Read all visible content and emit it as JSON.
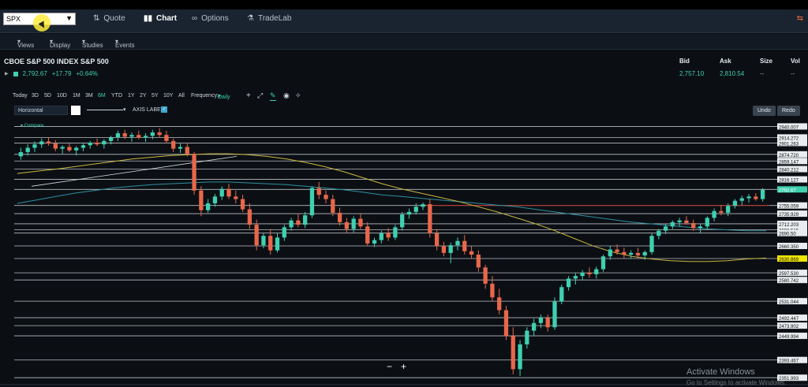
{
  "nav": {
    "symbol": "SPX",
    "tabs": [
      {
        "label": "Quote",
        "icon": "quote-icon"
      },
      {
        "label": "Chart",
        "icon": "chart-icon"
      },
      {
        "label": "Options",
        "icon": "options-icon"
      },
      {
        "label": "TradeLab",
        "icon": "tradelab-icon"
      }
    ]
  },
  "subnav": {
    "views": "Views",
    "display": "Display",
    "studies": "Studies",
    "events": "Events"
  },
  "instrument": {
    "title": "CBOE S&P 500 INDEX S&P 500",
    "last": "2,792.67",
    "change": "+17.79",
    "change_pct": "+0.64%"
  },
  "quote": {
    "bid_label": "Bid",
    "bid": "2,757.10",
    "ask_label": "Ask",
    "ask": "2,810.54",
    "size_label": "Size",
    "size": "--",
    "vol_label": "Vol",
    "vol": "--"
  },
  "toolbar": {
    "ranges": [
      "Today",
      "3D",
      "5D",
      "10D",
      "1M",
      "3M",
      "6M",
      "YTD",
      "1Y",
      "2Y",
      "5Y",
      "10Y",
      "All"
    ],
    "frequency_label": "Frequency:",
    "frequency": "Daily",
    "draw_tool": "Horizontal",
    "axis_label": "AXIS LABEL:",
    "undo": "Undo",
    "redo": "Redo"
  },
  "compare_label": "Compare...",
  "zoom": {
    "minus": "−",
    "plus": "+"
  },
  "watermark": {
    "title": "Activate Windows",
    "sub": "Go to Settings to activate Windows."
  },
  "colors": {
    "up": "#3fd0b0",
    "down": "#e8674a",
    "ma_short": "#c8b640",
    "ma_long": "#2f8fa0",
    "red_line": "#c0342f"
  },
  "chart_data": {
    "type": "candlestick",
    "y_axis_levels": [
      "2940.007",
      "2914.272",
      "2901.263",
      "2874.720",
      "2859.147",
      "2840.212",
      "2816.127",
      "2792.67",
      "2755.059",
      "2735.929",
      "2712.203",
      "2698.515",
      "2690.50",
      "2660.350",
      "2630.869",
      "2597.530",
      "2580.742",
      "2531.044",
      "2492.447",
      "2473.902",
      "2449.994",
      "2393.467",
      "2351.993"
    ],
    "y_axis_price_values": [
      2940.007,
      2914.272,
      2901.263,
      2874.72,
      2859.147,
      2840.212,
      2816.127,
      2792.67,
      2755.059,
      2735.929,
      2712.203,
      2698.515,
      2690.5,
      2660.35,
      2630.869,
      2597.53,
      2580.742,
      2531.044,
      2492.447,
      2473.902,
      2449.994,
      2393.467,
      2351.993
    ],
    "highlight_levels": {
      "last": "2792.67",
      "yellow": "2630.869"
    },
    "ylim": [
      2345,
      2950
    ],
    "candles": [
      [
        2870,
        2890,
        2862,
        2880
      ],
      [
        2880,
        2898,
        2872,
        2890
      ],
      [
        2890,
        2905,
        2880,
        2898
      ],
      [
        2898,
        2912,
        2890,
        2905
      ],
      [
        2905,
        2915,
        2895,
        2900
      ],
      [
        2900,
        2908,
        2882,
        2888
      ],
      [
        2888,
        2896,
        2876,
        2892
      ],
      [
        2892,
        2900,
        2880,
        2884
      ],
      [
        2884,
        2894,
        2872,
        2890
      ],
      [
        2890,
        2902,
        2882,
        2896
      ],
      [
        2896,
        2906,
        2888,
        2902
      ],
      [
        2902,
        2912,
        2894,
        2898
      ],
      [
        2898,
        2910,
        2888,
        2906
      ],
      [
        2906,
        2918,
        2898,
        2914
      ],
      [
        2914,
        2930,
        2906,
        2924
      ],
      [
        2924,
        2932,
        2910,
        2916
      ],
      [
        2916,
        2926,
        2904,
        2920
      ],
      [
        2920,
        2930,
        2910,
        2914
      ],
      [
        2914,
        2924,
        2904,
        2918
      ],
      [
        2918,
        2932,
        2910,
        2926
      ],
      [
        2926,
        2936,
        2914,
        2920
      ],
      [
        2920,
        2930,
        2900,
        2906
      ],
      [
        2906,
        2912,
        2880,
        2888
      ],
      [
        2888,
        2900,
        2878,
        2892
      ],
      [
        2892,
        2902,
        2870,
        2876
      ],
      [
        2876,
        2880,
        2780,
        2790
      ],
      [
        2790,
        2800,
        2730,
        2744
      ],
      [
        2744,
        2770,
        2738,
        2760
      ],
      [
        2760,
        2782,
        2752,
        2776
      ],
      [
        2776,
        2800,
        2768,
        2794
      ],
      [
        2794,
        2806,
        2770,
        2776
      ],
      [
        2776,
        2790,
        2760,
        2770
      ],
      [
        2770,
        2780,
        2740,
        2746
      ],
      [
        2746,
        2760,
        2700,
        2710
      ],
      [
        2710,
        2722,
        2650,
        2662
      ],
      [
        2662,
        2690,
        2655,
        2684
      ],
      [
        2684,
        2700,
        2640,
        2650
      ],
      [
        2650,
        2690,
        2645,
        2680
      ],
      [
        2680,
        2710,
        2672,
        2704
      ],
      [
        2704,
        2726,
        2696,
        2720
      ],
      [
        2720,
        2736,
        2704,
        2710
      ],
      [
        2710,
        2740,
        2702,
        2732
      ],
      [
        2732,
        2800,
        2726,
        2796
      ],
      [
        2796,
        2810,
        2770,
        2780
      ],
      [
        2780,
        2790,
        2760,
        2770
      ],
      [
        2770,
        2780,
        2730,
        2738
      ],
      [
        2738,
        2750,
        2708,
        2716
      ],
      [
        2716,
        2726,
        2690,
        2700
      ],
      [
        2700,
        2730,
        2692,
        2724
      ],
      [
        2724,
        2736,
        2700,
        2706
      ],
      [
        2706,
        2716,
        2660,
        2666
      ],
      [
        2666,
        2680,
        2658,
        2674
      ],
      [
        2674,
        2696,
        2666,
        2690
      ],
      [
        2690,
        2702,
        2672,
        2680
      ],
      [
        2680,
        2710,
        2674,
        2704
      ],
      [
        2704,
        2740,
        2696,
        2734
      ],
      [
        2734,
        2748,
        2724,
        2740
      ],
      [
        2740,
        2760,
        2734,
        2752
      ],
      [
        2752,
        2762,
        2744,
        2758
      ],
      [
        2758,
        2770,
        2680,
        2690
      ],
      [
        2690,
        2700,
        2650,
        2660
      ],
      [
        2660,
        2670,
        2636,
        2644
      ],
      [
        2644,
        2668,
        2620,
        2662
      ],
      [
        2662,
        2680,
        2650,
        2672
      ],
      [
        2672,
        2686,
        2640,
        2648
      ],
      [
        2648,
        2660,
        2630,
        2640
      ],
      [
        2640,
        2650,
        2600,
        2610
      ],
      [
        2610,
        2616,
        2560,
        2572
      ],
      [
        2572,
        2590,
        2530,
        2540
      ],
      [
        2540,
        2560,
        2500,
        2510
      ],
      [
        2510,
        2520,
        2440,
        2450
      ],
      [
        2450,
        2470,
        2360,
        2372
      ],
      [
        2372,
        2440,
        2356,
        2430
      ],
      [
        2430,
        2470,
        2420,
        2462
      ],
      [
        2462,
        2490,
        2450,
        2480
      ],
      [
        2480,
        2500,
        2468,
        2492
      ],
      [
        2492,
        2500,
        2460,
        2470
      ],
      [
        2470,
        2540,
        2464,
        2530
      ],
      [
        2530,
        2570,
        2524,
        2564
      ],
      [
        2564,
        2590,
        2556,
        2584
      ],
      [
        2584,
        2598,
        2570,
        2590
      ],
      [
        2590,
        2604,
        2580,
        2598
      ],
      [
        2598,
        2610,
        2586,
        2594
      ],
      [
        2594,
        2612,
        2584,
        2606
      ],
      [
        2606,
        2640,
        2600,
        2636
      ],
      [
        2636,
        2660,
        2628,
        2652
      ],
      [
        2652,
        2664,
        2640,
        2646
      ],
      [
        2646,
        2656,
        2632,
        2640
      ],
      [
        2640,
        2650,
        2630,
        2644
      ],
      [
        2644,
        2656,
        2632,
        2638
      ],
      [
        2638,
        2650,
        2628,
        2646
      ],
      [
        2646,
        2690,
        2640,
        2684
      ],
      [
        2684,
        2700,
        2676,
        2696
      ],
      [
        2696,
        2712,
        2688,
        2706
      ],
      [
        2706,
        2720,
        2700,
        2716
      ],
      [
        2716,
        2726,
        2706,
        2720
      ],
      [
        2720,
        2730,
        2710,
        2714
      ],
      [
        2714,
        2722,
        2696,
        2702
      ],
      [
        2702,
        2712,
        2690,
        2706
      ],
      [
        2706,
        2730,
        2700,
        2726
      ],
      [
        2726,
        2748,
        2718,
        2742
      ],
      [
        2742,
        2756,
        2732,
        2738
      ],
      [
        2738,
        2760,
        2730,
        2754
      ],
      [
        2754,
        2770,
        2748,
        2766
      ],
      [
        2766,
        2778,
        2756,
        2772
      ],
      [
        2772,
        2782,
        2762,
        2776
      ],
      [
        2776,
        2784,
        2766,
        2770
      ],
      [
        2770,
        2796,
        2764,
        2792
      ]
    ],
    "ma_short": [
      2830,
      2835,
      2840,
      2846,
      2852,
      2858,
      2864,
      2868,
      2872,
      2874,
      2876,
      2876,
      2874,
      2870,
      2864,
      2856,
      2846,
      2834,
      2820,
      2806,
      2794,
      2784,
      2774,
      2764,
      2752,
      2740,
      2726,
      2712,
      2696,
      2678,
      2660,
      2646,
      2636,
      2630,
      2626,
      2624,
      2624,
      2626,
      2630,
      2632
    ],
    "ma_long": [
      2760,
      2768,
      2776,
      2784,
      2790,
      2796,
      2800,
      2804,
      2806,
      2808,
      2810,
      2810,
      2808,
      2806,
      2804,
      2800,
      2796,
      2792,
      2786,
      2780,
      2776,
      2772,
      2768,
      2764,
      2760,
      2756,
      2752,
      2746,
      2740,
      2734,
      2728,
      2722,
      2716,
      2712,
      2708,
      2704,
      2700,
      2698,
      2696,
      2696
    ],
    "red_line_y": 2755.059
  }
}
